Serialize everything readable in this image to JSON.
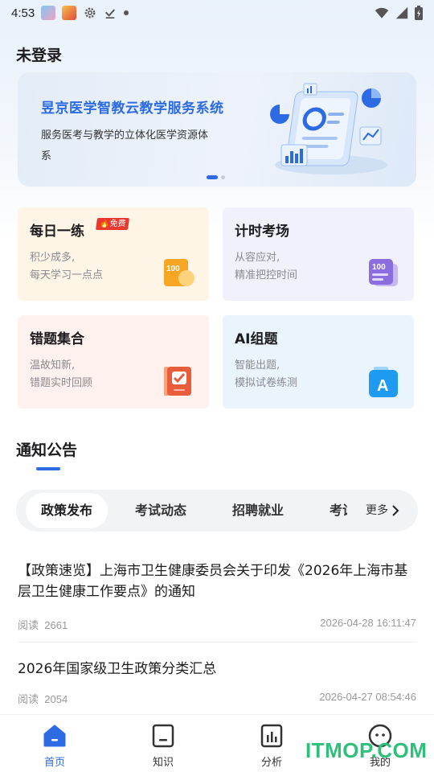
{
  "status_bar": {
    "time": "4:53",
    "icons": [
      "app-icon",
      "app-icon",
      "settings-icon",
      "download-done-icon",
      "dot-icon",
      "wifi-icon",
      "signal-icon",
      "battery-icon"
    ]
  },
  "header": {
    "title": "未登录"
  },
  "banner": {
    "title": "昱京医学智教云教学服务系统",
    "subtitle": "服务医考与教学的立体化医学资源体系",
    "page_count": 2,
    "active_page": 1
  },
  "cards": [
    {
      "title": "每日一练",
      "badge": "免费",
      "desc1": "积少成多,",
      "desc2": "每天学习一点点",
      "icon": "100-score-icon",
      "icon_text": "100"
    },
    {
      "title": "计时考场",
      "desc1": "从容应对,",
      "desc2": "精准把控时间",
      "icon": "exam-paper-icon",
      "icon_text": "100"
    },
    {
      "title": "错题集合",
      "desc1": "温故知新,",
      "desc2": "错题实时回顾",
      "icon": "check-notebook-icon"
    },
    {
      "title": "AI组题",
      "desc1": "智能出题,",
      "desc2": "模拟试卷练测",
      "icon": "ai-letter-icon",
      "icon_text": "A"
    }
  ],
  "notice": {
    "title": "通知公告",
    "tabs": [
      "政策发布",
      "考试动态",
      "招聘就业",
      "考试"
    ],
    "active_tab": 0,
    "more_label": "更多"
  },
  "articles": [
    {
      "title": "【政策速览】上海市卫生健康委员会关于印发《2026年上海市基层卫生健康工作要点》的通知",
      "reads_label": "阅读",
      "reads": "2661",
      "date": "2026-04-28 16:11:47"
    },
    {
      "title": "2026年国家级卫生政策分类汇总",
      "reads_label": "阅读",
      "reads": "2054",
      "date": "2026-04-27 08:54:46"
    }
  ],
  "tabbar": {
    "items": [
      {
        "label": "首页",
        "icon": "home-icon",
        "active": true
      },
      {
        "label": "知识",
        "icon": "knowledge-icon",
        "active": false
      },
      {
        "label": "分析",
        "icon": "analysis-icon",
        "active": false
      },
      {
        "label": "我的",
        "icon": "profile-icon",
        "active": false
      }
    ]
  },
  "watermark": "ITMOP.COM",
  "colors": {
    "accent": "#2d6be4",
    "badge": "#e9392f",
    "watermark": "#2fbf7a"
  }
}
